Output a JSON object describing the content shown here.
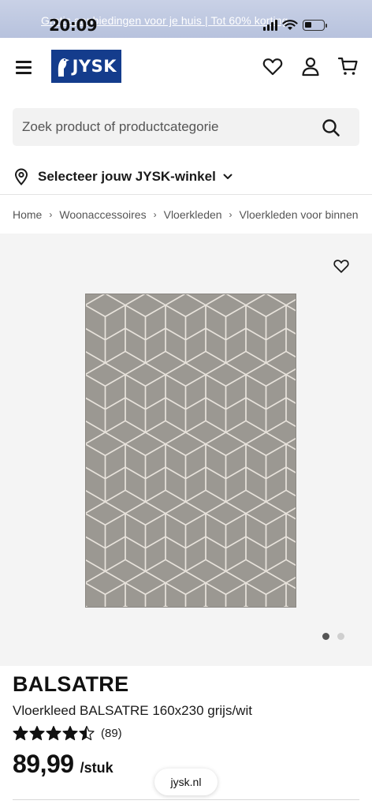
{
  "promo_banner": {
    "text": "Gratis aanbiedingen voor je huis | Tot 60% korting"
  },
  "status_bar": {
    "time": "20:09"
  },
  "header": {
    "logo_text": "JYSK",
    "icons": [
      "menu-icon",
      "heart-icon",
      "account-icon",
      "cart-icon"
    ]
  },
  "search": {
    "placeholder": "Zoek product of productcategorie"
  },
  "store_selector": {
    "label": "Selecteer jouw JYSK-winkel"
  },
  "breadcrumb": [
    "Home",
    "Woonaccessoires",
    "Vloerkleden",
    "Vloerkleden voor binnen"
  ],
  "gallery": {
    "image_count": 2,
    "active_index": 0
  },
  "product": {
    "brand": "BALSATRE",
    "title": "Vloerkleed BALSATRE 160x230 grijs/wit",
    "rating": 4.5,
    "review_count": "(89)",
    "price": "89,99",
    "unit": "/stuk"
  },
  "browser": {
    "url": "jysk.nl"
  },
  "colors": {
    "brand_blue": "#143c8c",
    "rug_gray": "#9b9892",
    "rug_lines": "#e8e3dc",
    "gallery_bg": "#f4f4f4"
  }
}
